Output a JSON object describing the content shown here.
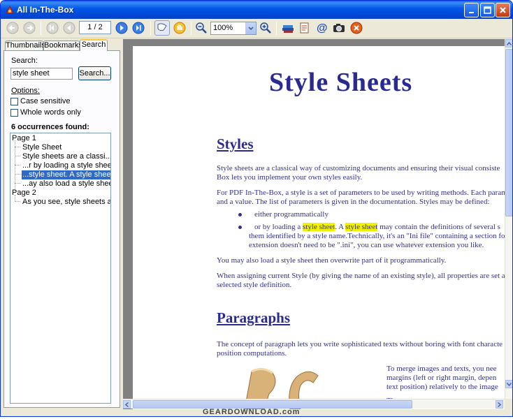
{
  "window": {
    "title": "All In-The-Box"
  },
  "toolbar": {
    "page_indicator": "1 / 2",
    "zoom_value": "100%"
  },
  "left_panel": {
    "tabs": [
      "Thumbnails",
      "Bookmarks",
      "Search"
    ],
    "active_tab": "Search",
    "search_label": "Search:",
    "search_value": "style sheet",
    "search_button": "Search...",
    "options_label": "Options:",
    "case_sensitive": "Case sensitive",
    "whole_words": "Whole words only",
    "occurrences": "6 occurrences found:",
    "tree": [
      {
        "label": "Page 1",
        "level": 0
      },
      {
        "label": "Style Sheet",
        "level": 1
      },
      {
        "label": "Style sheets are a classi...",
        "level": 1
      },
      {
        "label": "...r by loading a style sheet. A st",
        "level": 1
      },
      {
        "label": "...style sheet. A style sheet may",
        "level": 1,
        "selected": true
      },
      {
        "label": "...ay also load a style sheet ther",
        "level": 1
      },
      {
        "label": "Page 2",
        "level": 0
      },
      {
        "label": "As you see, style sheets and pa",
        "level": 1
      }
    ]
  },
  "document": {
    "title": "Style Sheets",
    "h_styles": "Styles",
    "p1a": "Style sheets are a classical way of customizing documents and ensuring their visual consiste",
    "p1b": "Box lets you implement your own styles easily.",
    "p2a": "For PDF In-The-Box, a style is a set of parameters to be used by writing methods. Each param",
    "p2b": "and a value. The list of parameters is given in the documentation. Styles may be defined:",
    "b1": "either programmatically",
    "b2_pre": "or by loading a ",
    "b2_hl1": "style sheet",
    "b2_mid": ". A ",
    "b2_hl2": "style sheet",
    "b2_post": " may contain the definitions of several s",
    "b2_l2": "them identified by a style name.Technically, it's an \"Ini file\" containing a section fo",
    "b2_l3": "extension doesn't need to be \".ini\", you can use whatever extension you like.",
    "p3": "You may also load a style sheet then overwrite part of it programmatically.",
    "p4a": "When assigning current Style (by giving the name of an existing style), all properties are set a",
    "p4b": "selected style definition.",
    "h_paragraphs": "Paragraphs",
    "p5a": "The concept of paragraph lets you write sophisticated texts without boring with font characte",
    "p5b": "position computations.",
    "p6a": "To merge images and texts, you nee",
    "p6b": "margins (left or right margin, depen",
    "p6c": "text position) relatively to the image",
    "p7": "Th"
  },
  "watermark": "GEARDOWNLOAD.com",
  "colors": {
    "title_bar": "#0055e5",
    "selection": "#316ac5",
    "highlight": "#f2f200",
    "doc_text": "#303090"
  }
}
